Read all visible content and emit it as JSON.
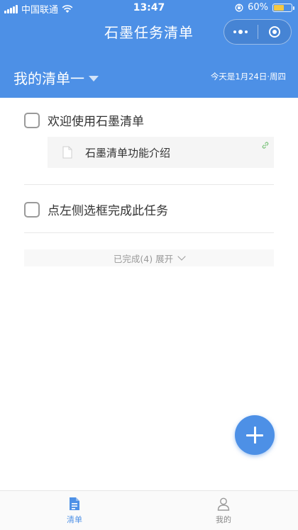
{
  "status_bar": {
    "carrier": "中国联通",
    "time": "13:47",
    "battery": "60%",
    "battery_level": 0.6
  },
  "header": {
    "app_title": "石墨任务清单",
    "list_name": "我的清单一",
    "date_text": "今天是1月24日·周四",
    "capsule_icons": [
      "more-dots-icon",
      "target-icon"
    ]
  },
  "tasks": [
    {
      "text": "欢迎使用石墨清单",
      "checked": false,
      "note": {
        "text": "石墨清单功能介绍",
        "icon": "document-icon",
        "link_icon": "link-icon"
      }
    },
    {
      "text": "点左侧选框完成此任务",
      "checked": false
    }
  ],
  "completed_toggle": {
    "label": "已完成(4) 展开"
  },
  "fab": {
    "icon": "plus-icon"
  },
  "tabbar": {
    "tabs": [
      {
        "label": "清单",
        "icon": "list-doc-icon",
        "active": true
      },
      {
        "label": "我的",
        "icon": "user-icon",
        "active": false
      }
    ]
  },
  "colors": {
    "primary": "#4d90e6",
    "battery_fill": "#f5c842",
    "text": "#333333",
    "muted": "#999999"
  }
}
